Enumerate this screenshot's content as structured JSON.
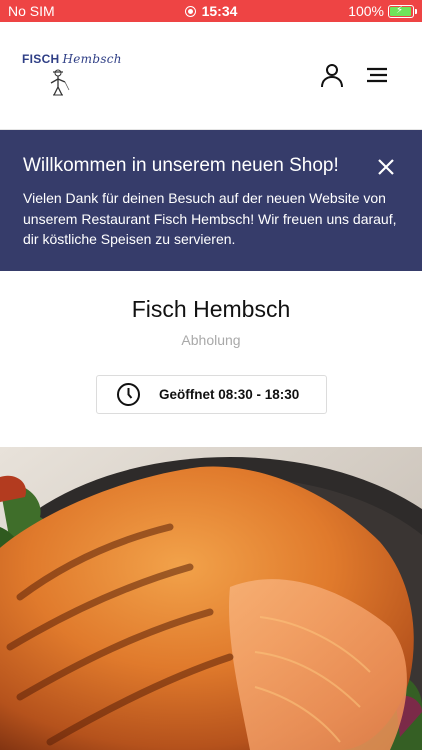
{
  "status_bar": {
    "carrier": "No SIM",
    "time": "15:34",
    "battery": "100%",
    "battery_level": 1.0
  },
  "header": {
    "logo_text": "FISCH",
    "logo_script": "Hembsch",
    "user_icon": "user-icon",
    "menu_icon": "hamburger-menu-icon"
  },
  "banner": {
    "title": "Willkommen in unserem neuen Shop!",
    "text": "Vielen Dank für deinen Besuch auf der neuen Website von unserem Restaurant Fisch Hembsch! Wir freuen uns darauf, dir köstliche Speisen zu servieren.",
    "close_icon": "close-icon"
  },
  "shop": {
    "name": "Fisch Hembsch",
    "mode": "Abholung",
    "hours": "Geöffnet 08:30 - 18:30",
    "clock_icon": "clock-icon"
  },
  "colors": {
    "status_bar": "#ee4444",
    "banner": "#363c6a",
    "brand": "#2f3f86"
  }
}
